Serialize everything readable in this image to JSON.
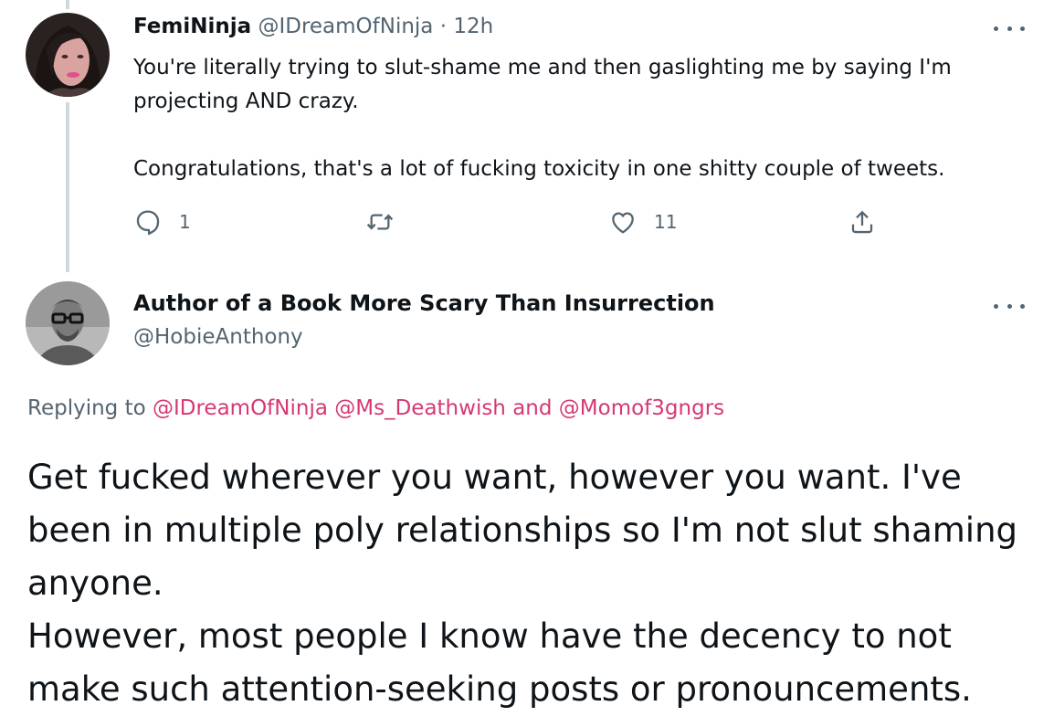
{
  "tweet_parent": {
    "display_name": "FemiNinja",
    "handle": "@IDreamOfNinja",
    "separator": "·",
    "time": "12h",
    "text": "You're literally trying to slut-shame me and then gaslighting me by saying I'm projecting AND crazy.\n\nCongratulations, that's a lot of fucking toxicity in one shitty couple of tweets.",
    "actions": {
      "reply_icon": "reply-bubble-icon",
      "reply_count": "1",
      "retweet_icon": "retweet-icon",
      "retweet_count": "",
      "like_icon": "heart-icon",
      "like_count": "11",
      "share_icon": "share-upload-icon"
    }
  },
  "tweet_main": {
    "display_name": "Author of a Book More Scary Than Insurrection",
    "handle": "@HobieAnthony",
    "replying_label": "Replying to",
    "mentions": [
      "@IDreamOfNinja",
      "@Ms_Deathwish",
      "@Momof3gngrs"
    ],
    "mention_joiner": "and",
    "text": "Get fucked wherever you want, however you want. I've been in multiple poly relationships so I'm not slut shaming anyone.\nHowever, most people I know have the decency to not make such attention-seeking posts or pronouncements."
  },
  "colors": {
    "text_primary": "#0f1419",
    "text_secondary": "#536471",
    "mention_accent": "#d63874",
    "thread_line": "#cfd9de"
  }
}
